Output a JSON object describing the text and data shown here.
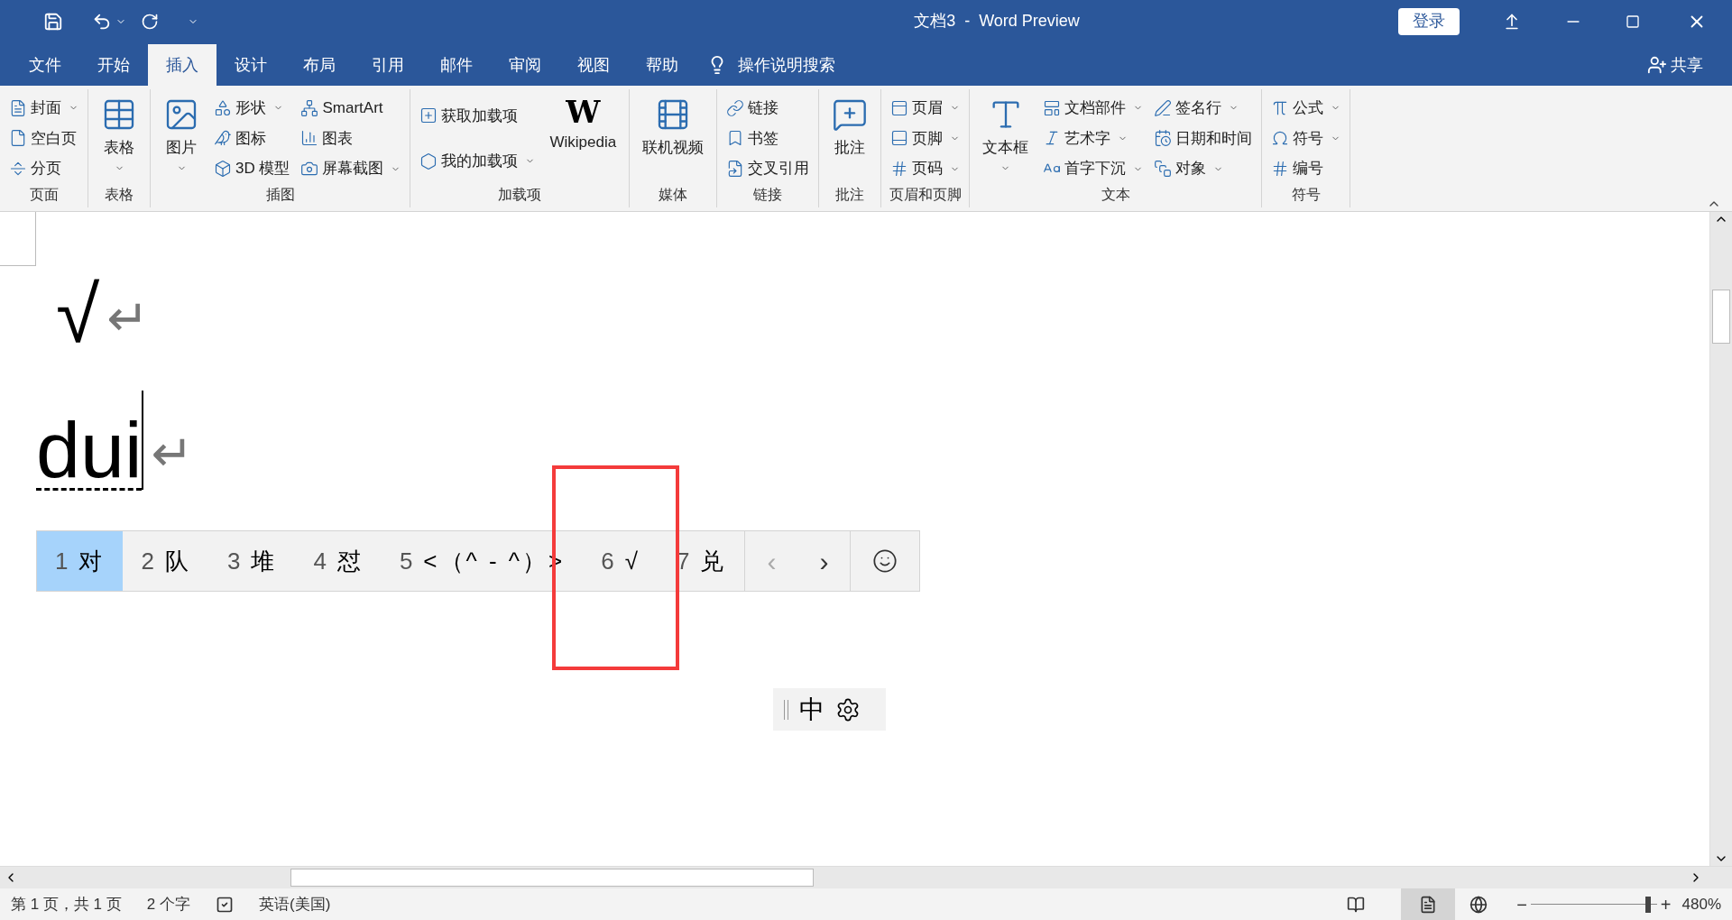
{
  "window": {
    "title": "文档3  -  Word Preview",
    "sign_in": "登录"
  },
  "tabs": [
    {
      "label": "文件",
      "selected": false
    },
    {
      "label": "开始",
      "selected": false
    },
    {
      "label": "插入",
      "selected": true
    },
    {
      "label": "设计",
      "selected": false
    },
    {
      "label": "布局",
      "selected": false
    },
    {
      "label": "引用",
      "selected": false
    },
    {
      "label": "邮件",
      "selected": false
    },
    {
      "label": "审阅",
      "selected": false
    },
    {
      "label": "视图",
      "selected": false
    },
    {
      "label": "帮助",
      "selected": false
    }
  ],
  "tell_me": "操作说明搜索",
  "share": "共享",
  "ribbon": {
    "groups": [
      {
        "label": "页面",
        "items": [
          {
            "kind": "small",
            "label": "封面",
            "dropdown": true
          },
          {
            "kind": "small",
            "label": "空白页",
            "dropdown": false
          },
          {
            "kind": "small",
            "label": "分页",
            "dropdown": false
          }
        ]
      },
      {
        "label": "表格",
        "items": [
          {
            "kind": "large",
            "label": "表格",
            "dropdown": true
          }
        ]
      },
      {
        "label": "插图",
        "items": [
          {
            "kind": "large",
            "label": "图片",
            "dropdown": true
          },
          {
            "kind": "small",
            "label": "形状",
            "dropdown": true
          },
          {
            "kind": "small",
            "label": "图标",
            "dropdown": false
          },
          {
            "kind": "small",
            "label": "3D 模型",
            "dropdown": false
          },
          {
            "kind": "small",
            "label": "SmartArt",
            "dropdown": false
          },
          {
            "kind": "small",
            "label": "图表",
            "dropdown": false
          },
          {
            "kind": "small",
            "label": "屏幕截图",
            "dropdown": true
          }
        ]
      },
      {
        "label": "加载项",
        "items": [
          {
            "kind": "small",
            "label": "获取加载项",
            "dropdown": false
          },
          {
            "kind": "small",
            "label": "我的加载项",
            "dropdown": true
          },
          {
            "kind": "large",
            "label": "Wikipedia",
            "dropdown": false,
            "logo": "W"
          }
        ]
      },
      {
        "label": "媒体",
        "items": [
          {
            "kind": "large",
            "label": "联机视频",
            "dropdown": false
          }
        ]
      },
      {
        "label": "链接",
        "items": [
          {
            "kind": "small",
            "label": "链接",
            "dropdown": false
          },
          {
            "kind": "small",
            "label": "书签",
            "dropdown": false
          },
          {
            "kind": "small",
            "label": "交叉引用",
            "dropdown": false
          }
        ]
      },
      {
        "label": "批注",
        "items": [
          {
            "kind": "large",
            "label": "批注",
            "dropdown": false
          }
        ]
      },
      {
        "label": "页眉和页脚",
        "items": [
          {
            "kind": "small",
            "label": "页眉",
            "dropdown": true
          },
          {
            "kind": "small",
            "label": "页脚",
            "dropdown": true
          },
          {
            "kind": "small",
            "label": "页码",
            "dropdown": true
          }
        ]
      },
      {
        "label": "文本",
        "items": [
          {
            "kind": "large",
            "label": "文本框",
            "dropdown": true
          },
          {
            "kind": "small",
            "label": "文档部件",
            "dropdown": true
          },
          {
            "kind": "small",
            "label": "艺术字",
            "dropdown": true
          },
          {
            "kind": "small",
            "label": "首字下沉",
            "dropdown": true
          },
          {
            "kind": "small",
            "label": "签名行",
            "dropdown": true
          },
          {
            "kind": "small",
            "label": "日期和时间",
            "dropdown": false
          },
          {
            "kind": "small",
            "label": "对象",
            "dropdown": true
          }
        ]
      },
      {
        "label": "符号",
        "items": [
          {
            "kind": "small",
            "label": "公式",
            "dropdown": true
          },
          {
            "kind": "small",
            "label": "符号",
            "dropdown": true
          },
          {
            "kind": "small",
            "label": "编号",
            "dropdown": false
          }
        ]
      }
    ]
  },
  "document": {
    "lines": [
      {
        "text": "√",
        "mark": "↵",
        "composing": false
      },
      {
        "text": "dui",
        "mark": "↵",
        "composing": true
      }
    ]
  },
  "candidates": {
    "items": [
      {
        "number": "1",
        "text": "对",
        "selected": true
      },
      {
        "number": "2",
        "text": "队",
        "selected": false
      },
      {
        "number": "3",
        "text": "堆",
        "selected": false
      },
      {
        "number": "4",
        "text": "怼",
        "selected": false
      },
      {
        "number": "5",
        "text": "<（^ - ^）>",
        "selected": false
      },
      {
        "number": "6",
        "text": "√",
        "selected": false
      },
      {
        "number": "7",
        "text": "兑",
        "selected": false
      }
    ],
    "prev": "‹",
    "next": "›"
  },
  "ime_bar": {
    "mode": "中"
  },
  "status_bar": {
    "page": "第 1 页，共 1 页",
    "words": "2 个字",
    "language": "英语(美国)",
    "zoom": {
      "out": "−",
      "level": 0.93,
      "in": "+",
      "text": "480%"
    }
  }
}
